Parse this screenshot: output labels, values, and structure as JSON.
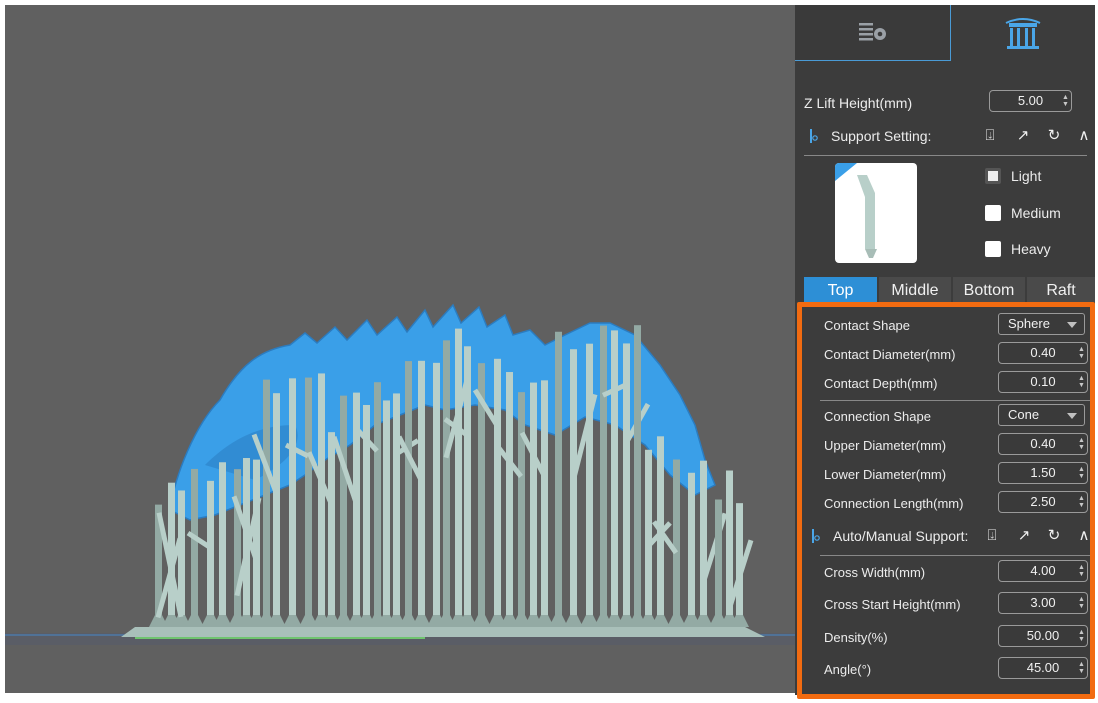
{
  "tabs": {
    "layer_icon": "layer-settings-icon",
    "support_icon": "support-icon"
  },
  "z_lift": {
    "label": "Z Lift Height(mm)",
    "value": "5.00"
  },
  "support_setting": {
    "label": "Support Setting:"
  },
  "presets": [
    {
      "label": "Light"
    },
    {
      "label": "Medium"
    },
    {
      "label": "Heavy"
    }
  ],
  "subtabs": [
    "Top",
    "Middle",
    "Bottom",
    "Raft"
  ],
  "top": {
    "contact_shape": {
      "label": "Contact Shape",
      "value": "Sphere"
    },
    "contact_diameter": {
      "label": "Contact Diameter(mm)",
      "value": "0.40"
    },
    "contact_depth": {
      "label": "Contact Depth(mm)",
      "value": "0.10"
    },
    "connection_shape": {
      "label": "Connection Shape",
      "value": "Cone"
    },
    "upper_diameter": {
      "label": "Upper Diameter(mm)",
      "value": "0.40"
    },
    "lower_diameter": {
      "label": "Lower Diameter(mm)",
      "value": "1.50"
    },
    "connection_length": {
      "label": "Connection Length(mm)",
      "value": "2.50"
    }
  },
  "auto_manual": {
    "label": "Auto/Manual Support:"
  },
  "cross": {
    "cross_width": {
      "label": "Cross Width(mm)",
      "value": "4.00"
    },
    "cross_start_height": {
      "label": "Cross Start Height(mm)",
      "value": "3.00"
    },
    "density": {
      "label": "Density(%)",
      "value": "50.00"
    },
    "angle": {
      "label": "Angle(°)",
      "value": "45.00"
    }
  },
  "colors": {
    "accent": "#2d8fd6",
    "highlight": "#f26b11",
    "model": "#3a9fe8",
    "supports": "#b8cfc9",
    "viewport_bg": "#606060",
    "panel_bg": "#3c3c3c"
  }
}
